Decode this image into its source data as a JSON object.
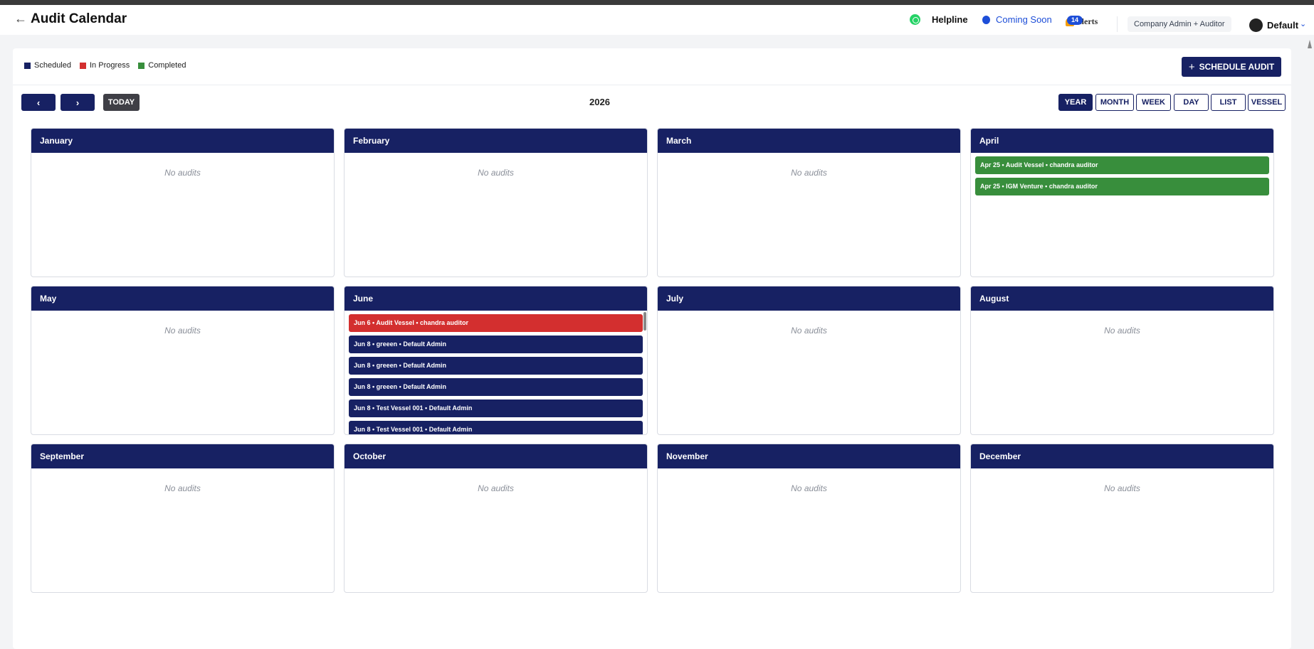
{
  "header": {
    "title": "Audit Calendar",
    "back_icon": "←",
    "helpline": "Helpline",
    "coming_soon": "Coming Soon",
    "alerts": "Alerts",
    "alerts_count": "14",
    "role": "Company Admin + Auditor",
    "user": "Default"
  },
  "legend": [
    {
      "label": "Scheduled",
      "color": "#172163"
    },
    {
      "label": "In Progress",
      "color": "#d32f2f"
    },
    {
      "label": "Completed",
      "color": "#388e3c"
    }
  ],
  "toolbar": {
    "schedule_label": "SCHEDULE AUDIT",
    "prev": "‹",
    "next": "›",
    "today": "TODAY",
    "year": "2026",
    "views": [
      "YEAR",
      "MONTH",
      "WEEK",
      "DAY",
      "LIST",
      "VESSEL"
    ],
    "active_view": "YEAR"
  },
  "empty_text": "No audits",
  "months": [
    {
      "name": "January",
      "events": []
    },
    {
      "name": "February",
      "events": []
    },
    {
      "name": "March",
      "events": []
    },
    {
      "name": "April",
      "events": [
        {
          "text": "Apr 25 • Audit Vessel • chandra auditor",
          "status": "completed"
        },
        {
          "text": "Apr 25 • IGM Venture • chandra auditor",
          "status": "completed"
        }
      ]
    },
    {
      "name": "May",
      "events": []
    },
    {
      "name": "June",
      "events": [
        {
          "text": "Jun 6 • Audit Vessel • chandra auditor",
          "status": "inprogress"
        },
        {
          "text": "Jun 8 • greeen • Default Admin",
          "status": "scheduled"
        },
        {
          "text": "Jun 8 • greeen • Default Admin",
          "status": "scheduled"
        },
        {
          "text": "Jun 8 • greeen • Default Admin",
          "status": "scheduled"
        },
        {
          "text": "Jun 8 • Test Vessel 001 • Default Admin",
          "status": "scheduled"
        },
        {
          "text": "Jun 8 • Test Vessel 001 • Default Admin",
          "status": "scheduled"
        }
      ]
    },
    {
      "name": "July",
      "events": []
    },
    {
      "name": "August",
      "events": []
    },
    {
      "name": "September",
      "events": []
    },
    {
      "name": "October",
      "events": []
    },
    {
      "name": "November",
      "events": []
    },
    {
      "name": "December",
      "events": []
    }
  ]
}
